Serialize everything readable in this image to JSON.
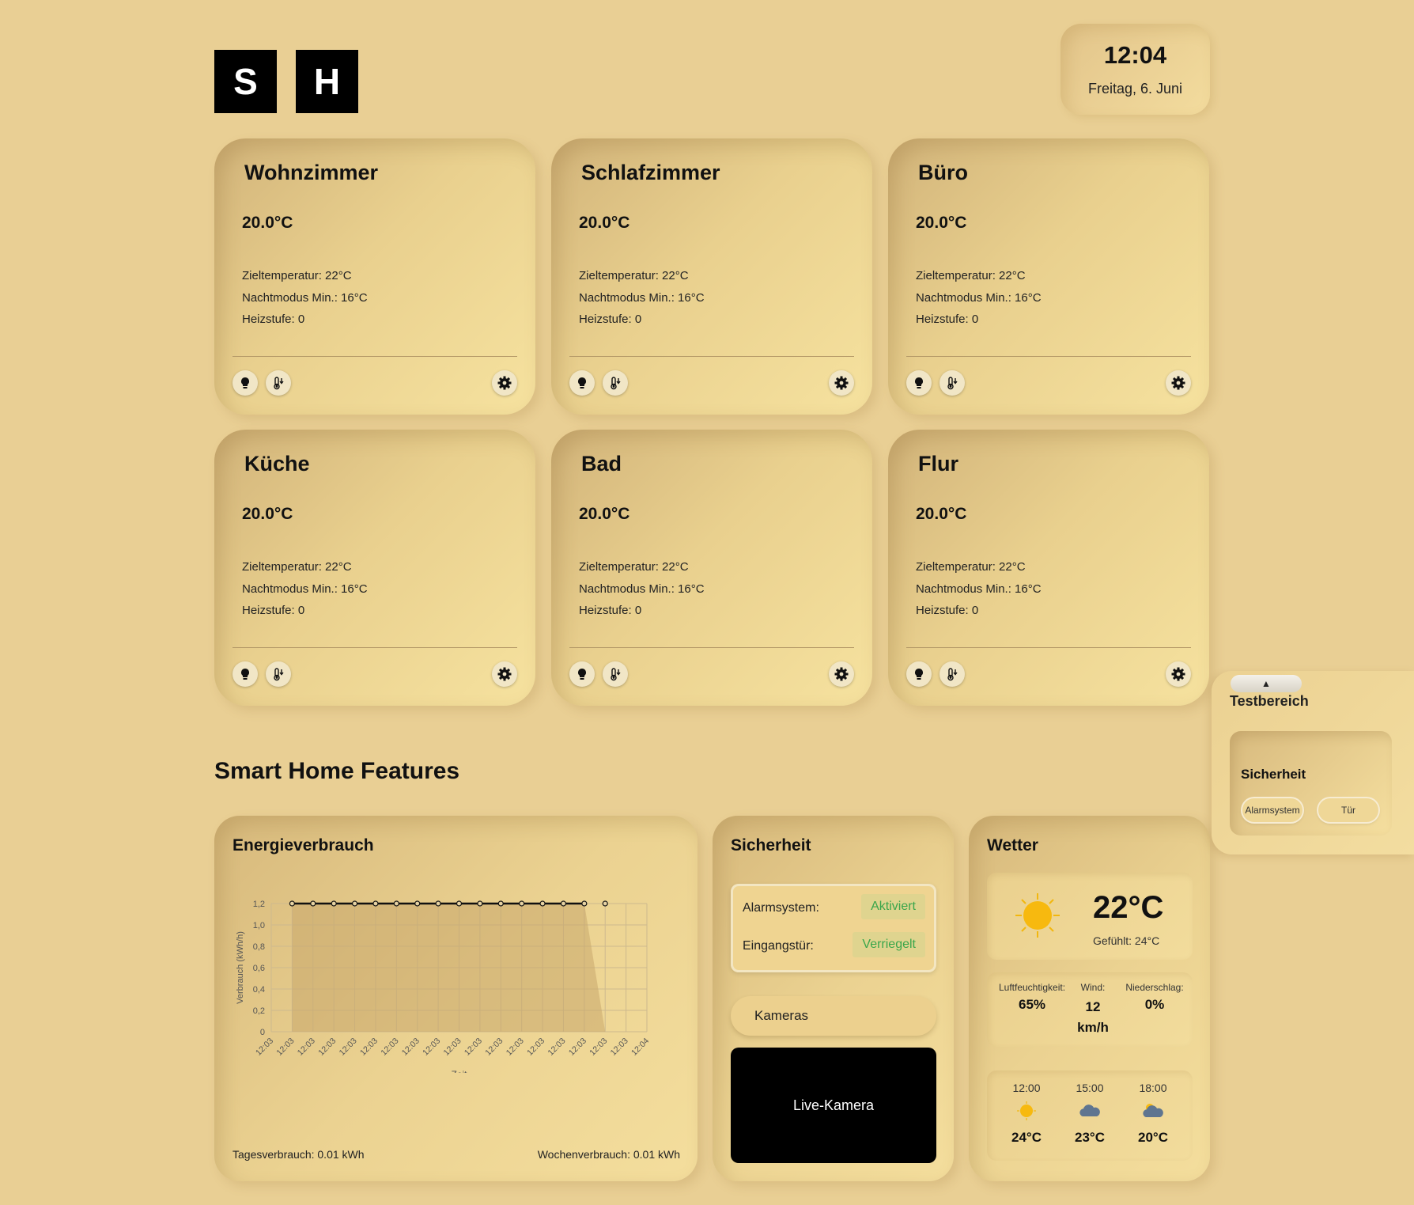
{
  "header": {
    "logo_letters": [
      "S",
      "H"
    ],
    "time": "12:04",
    "date": "Freitag, 6. Juni"
  },
  "rooms": [
    {
      "name": "Wohnzimmer",
      "temp": "20.0°C",
      "target": "Zieltemperatur: 22°C",
      "night": "Nachtmodus Min.: 16°C",
      "level": "Heizstufe: 0"
    },
    {
      "name": "Schlafzimmer",
      "temp": "20.0°C",
      "target": "Zieltemperatur: 22°C",
      "night": "Nachtmodus Min.: 16°C",
      "level": "Heizstufe: 0"
    },
    {
      "name": "Büro",
      "temp": "20.0°C",
      "target": "Zieltemperatur: 22°C",
      "night": "Nachtmodus Min.: 16°C",
      "level": "Heizstufe: 0"
    },
    {
      "name": "Küche",
      "temp": "20.0°C",
      "target": "Zieltemperatur: 22°C",
      "night": "Nachtmodus Min.: 16°C",
      "level": "Heizstufe: 0"
    },
    {
      "name": "Bad",
      "temp": "20.0°C",
      "target": "Zieltemperatur: 22°C",
      "night": "Nachtmodus Min.: 16°C",
      "level": "Heizstufe: 0"
    },
    {
      "name": "Flur",
      "temp": "20.0°C",
      "target": "Zieltemperatur: 22°C",
      "night": "Nachtmodus Min.: 16°C",
      "level": "Heizstufe: 0"
    }
  ],
  "room_icons": [
    "bulb-icon",
    "thermometer-down-icon",
    "gear-icon"
  ],
  "features_title": "Smart Home Features",
  "energy": {
    "title": "Energieverbrauch",
    "daily": "Tagesverbrauch: 0.01 kWh",
    "weekly": "Wochenverbrauch: 0.01 kWh"
  },
  "chart_data": {
    "type": "area",
    "title": "",
    "xlabel": "Zeit",
    "ylabel": "Verbrauch (kWh/h)",
    "x": [
      "12:03",
      "12:03",
      "12:03",
      "12:03",
      "12:03",
      "12:03",
      "12:03",
      "12:03",
      "12:03",
      "12:03",
      "12:03",
      "12:03",
      "12:03",
      "12:03",
      "12:03",
      "12:03",
      "12:03",
      "12:03",
      "12:04"
    ],
    "y_ticks": [
      "0",
      "0,2",
      "0,4",
      "0,6",
      "0,8",
      "1,0",
      "1,2"
    ],
    "ylim": [
      0,
      1.2
    ],
    "series": [
      {
        "values": [
          null,
          1.2,
          1.2,
          1.2,
          1.2,
          1.2,
          1.2,
          1.2,
          1.2,
          1.2,
          1.2,
          1.2,
          1.2,
          1.2,
          1.2,
          1.2,
          0,
          0,
          0
        ]
      }
    ],
    "grid": true,
    "colors": {
      "line": "#111111",
      "fill": "#c9a86c"
    }
  },
  "security": {
    "title": "Sicherheit",
    "alarm_label": "Alarmsystem:",
    "alarm_status": "Aktiviert",
    "door_label": "Eingangstür:",
    "door_status": "Verriegelt",
    "cameras_button": "Kameras",
    "live_camera": "Live-Kamera",
    "status_color": "#3aa64b"
  },
  "weather": {
    "title": "Wetter",
    "temp": "22°C",
    "feels": "Gefühlt: 24°C",
    "humidity_label": "Luftfeuchtigkeit:",
    "humidity": "65%",
    "wind_label": "Wind:",
    "wind": "12 km/h",
    "rain_label": "Niederschlag:",
    "rain": "0%",
    "forecast": [
      {
        "time": "12:00",
        "icon": "sun-icon",
        "temp": "24°C"
      },
      {
        "time": "15:00",
        "icon": "cloud-icon",
        "temp": "23°C"
      },
      {
        "time": "18:00",
        "icon": "partly-cloudy-icon",
        "temp": "20°C"
      }
    ]
  },
  "testbereich": {
    "toggle": "▲",
    "title": "Testbereich",
    "card_title": "Sicherheit",
    "alarm_button": "Alarmsystem",
    "door_button": "Tür"
  }
}
